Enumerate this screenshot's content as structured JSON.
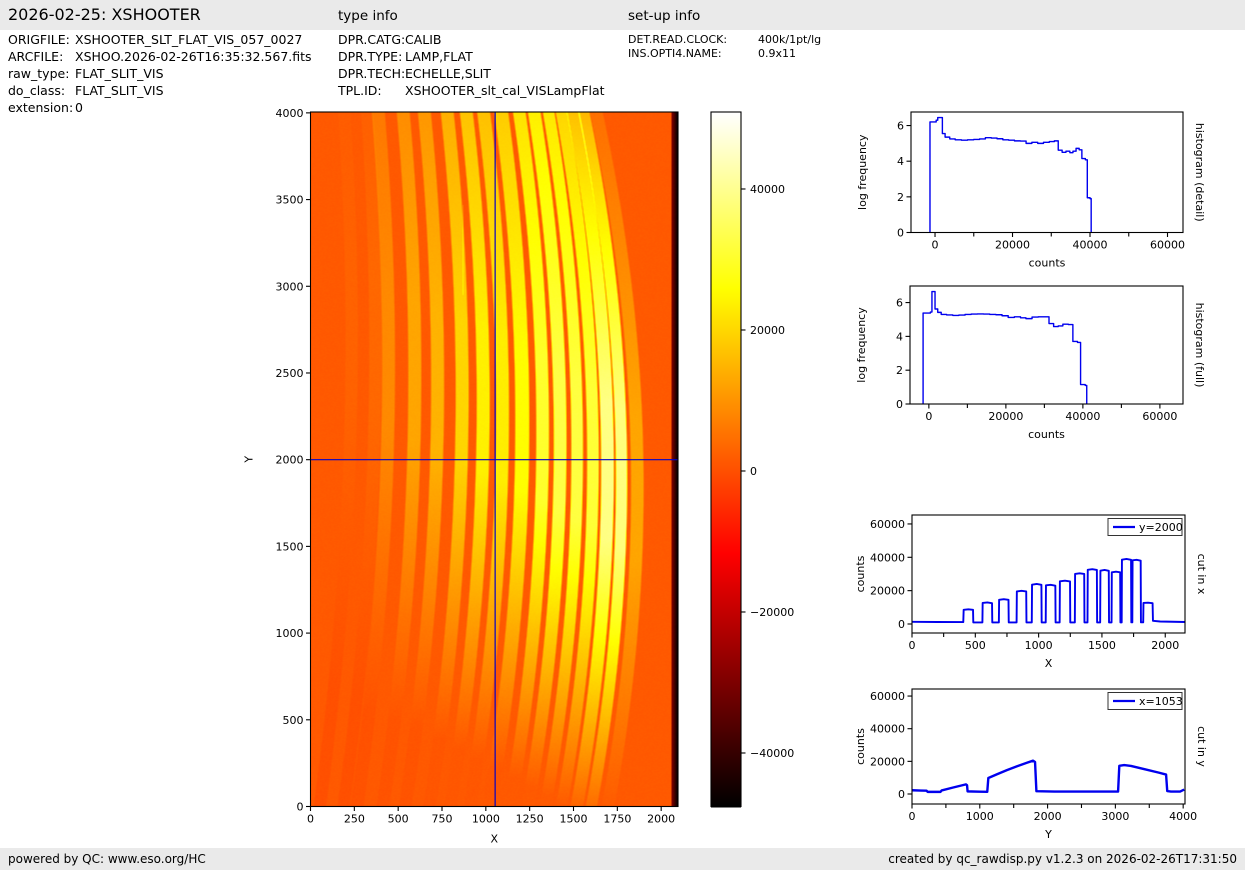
{
  "header": {
    "title": "2026-02-25: XSHOOTER",
    "type_info_title": "type info",
    "setup_info_title": "set-up info"
  },
  "file_info": {
    "rows": [
      {
        "label": "ORIGFILE:",
        "value": "XSHOOTER_SLT_FLAT_VIS_057_0027"
      },
      {
        "label": "ARCFILE:",
        "value": "XSHOO.2026-02-26T16:35:32.567.fits"
      },
      {
        "label": "raw_type:",
        "value": "FLAT_SLIT_VIS"
      },
      {
        "label": "do_class:",
        "value": "FLAT_SLIT_VIS"
      },
      {
        "label": "extension:",
        "value": "0"
      }
    ]
  },
  "type_info": {
    "rows": [
      {
        "label": "DPR.CATG:",
        "value": "CALIB"
      },
      {
        "label": "DPR.TYPE:",
        "value": "LAMP,FLAT"
      },
      {
        "label": "DPR.TECH:",
        "value": "ECHELLE,SLIT"
      },
      {
        "label": "TPL.ID:",
        "value": "XSHOOTER_slt_cal_VISLampFlat"
      }
    ]
  },
  "setup_info": {
    "rows": [
      {
        "label": "DET.READ.CLOCK:",
        "value": "400k/1pt/lg"
      },
      {
        "label": "INS.OPTI4.NAME:",
        "value": "0.9x11"
      }
    ]
  },
  "footer": {
    "left": "powered by QC: www.eso.org/HC",
    "right": "created by qc_rawdisp.py v1.2.3 on 2026-02-26T17:31:50"
  },
  "chart_data": [
    {
      "id": "image",
      "type": "heatmap",
      "colormap": "hot",
      "xlabel": "X",
      "ylabel": "Y",
      "xlim": [
        0,
        2096
      ],
      "ylim": [
        0,
        4005
      ],
      "xticks": [
        0,
        250,
        500,
        750,
        1000,
        1250,
        1500,
        1750,
        2000
      ],
      "yticks": [
        0,
        500,
        1000,
        1500,
        2000,
        2500,
        3000,
        3500,
        4000
      ],
      "background_value": 1500,
      "cursor": {
        "x": 1053,
        "y": 2000,
        "color": "#0000cc"
      },
      "stripe_fields": [
        "center",
        "halfwidth",
        "peak_counts",
        "curve_amp",
        "blaze_center_y",
        "top_fade"
      ],
      "stripes": [
        [
          235,
          35,
          2800,
          95,
          2700,
          0.7
        ],
        [
          370,
          35,
          3600,
          98,
          2650,
          0.7
        ],
        [
          445,
          37,
          8600,
          105,
          2550,
          0.72
        ],
        [
          595,
          37,
          12700,
          111,
          2495,
          0.72
        ],
        [
          725,
          37,
          14700,
          118,
          2440,
          0.72
        ],
        [
          865,
          37,
          19700,
          124,
          2385,
          0.72
        ],
        [
          985,
          37,
          23800,
          131,
          2330,
          0.72
        ],
        [
          1095,
          37,
          23300,
          137,
          2275,
          0.72
        ],
        [
          1208,
          40,
          25800,
          144,
          2220,
          0.72
        ],
        [
          1324,
          36,
          30200,
          150,
          2165,
          0.72
        ],
        [
          1424,
          36,
          32700,
          157,
          2110,
          0.72
        ],
        [
          1521,
          33,
          32200,
          163,
          2055,
          0.7
        ],
        [
          1611,
          33,
          31200,
          170,
          2000,
          0.64
        ],
        [
          1694,
          36,
          38800,
          176,
          1945,
          0.43
        ],
        [
          1774,
          32,
          38200,
          183,
          1890,
          0.4
        ],
        [
          1864,
          36,
          12700,
          189,
          1835,
          0.38
        ]
      ],
      "right_edge": {
        "x_start": 2062,
        "value": -30000
      },
      "artifact_line": {
        "x": 868,
        "y_from": 2950,
        "y_to": 3470,
        "delta": 5500
      }
    },
    {
      "id": "colorbar",
      "type": "colorbar",
      "colormap": "hot",
      "vmin": -47590,
      "vmax": 50920,
      "ticks": [
        40000,
        20000,
        0,
        -20000,
        -40000
      ]
    },
    {
      "id": "hist_detail",
      "type": "line",
      "mode": "step",
      "xlabel": "counts",
      "ylabel": "log frequency",
      "right_label": "histogram (detail)",
      "color": "#0000ee",
      "linewidth": 1.4,
      "xlim": [
        -6200,
        64000
      ],
      "ylim": [
        0,
        6.76
      ],
      "xticks": [
        0,
        20000,
        40000,
        60000
      ],
      "xminor": [
        10000,
        30000,
        50000
      ],
      "yticks": [
        0,
        2,
        4,
        6
      ],
      "points": [
        [
          -1300,
          6.2
        ],
        [
          300,
          6.3
        ],
        [
          700,
          6.45
        ],
        [
          1900,
          5.55
        ],
        [
          2600,
          5.35
        ],
        [
          3800,
          5.25
        ],
        [
          5200,
          5.2
        ],
        [
          6800,
          5.18
        ],
        [
          8400,
          5.2
        ],
        [
          10000,
          5.22
        ],
        [
          11500,
          5.25
        ],
        [
          13000,
          5.32
        ],
        [
          14500,
          5.3
        ],
        [
          16000,
          5.26
        ],
        [
          17500,
          5.2
        ],
        [
          19000,
          5.18
        ],
        [
          20500,
          5.14
        ],
        [
          22000,
          5.13
        ],
        [
          23500,
          5.0
        ],
        [
          25000,
          5.06
        ],
        [
          26500,
          5.0
        ],
        [
          28000,
          5.06
        ],
        [
          29500,
          5.1
        ],
        [
          30800,
          5.14
        ],
        [
          31800,
          4.62
        ],
        [
          32800,
          4.5
        ],
        [
          33800,
          4.56
        ],
        [
          34800,
          4.48
        ],
        [
          35600,
          4.56
        ],
        [
          36400,
          4.72
        ],
        [
          37200,
          4.64
        ],
        [
          37900,
          4.15
        ],
        [
          38800,
          4.08
        ],
        [
          39300,
          1.95
        ],
        [
          40000,
          1.9
        ],
        [
          40300,
          0
        ]
      ]
    },
    {
      "id": "hist_full",
      "type": "line",
      "mode": "step",
      "xlabel": "counts",
      "ylabel": "log frequency",
      "right_label": "histogram (full)",
      "color": "#0000ee",
      "linewidth": 1.4,
      "xlim": [
        -4900,
        66000
      ],
      "ylim": [
        0,
        6.98
      ],
      "xticks": [
        0,
        20000,
        40000,
        60000
      ],
      "xminor": [
        10000,
        30000,
        50000
      ],
      "yticks": [
        0,
        2,
        4,
        6
      ],
      "points": [
        [
          -1500,
          5.38
        ],
        [
          400,
          5.44
        ],
        [
          800,
          6.65
        ],
        [
          1600,
          5.62
        ],
        [
          2300,
          5.42
        ],
        [
          3200,
          5.3
        ],
        [
          4600,
          5.27
        ],
        [
          6200,
          5.24
        ],
        [
          7800,
          5.26
        ],
        [
          9400,
          5.3
        ],
        [
          11000,
          5.32
        ],
        [
          12600,
          5.33
        ],
        [
          14200,
          5.32
        ],
        [
          15800,
          5.3
        ],
        [
          17400,
          5.28
        ],
        [
          19000,
          5.22
        ],
        [
          20600,
          5.12
        ],
        [
          22200,
          5.16
        ],
        [
          23800,
          5.1
        ],
        [
          25200,
          5.05
        ],
        [
          26800,
          5.14
        ],
        [
          28400,
          5.16
        ],
        [
          30000,
          5.16
        ],
        [
          31200,
          4.76
        ],
        [
          32400,
          4.58
        ],
        [
          33600,
          4.62
        ],
        [
          34800,
          4.72
        ],
        [
          36200,
          4.7
        ],
        [
          37400,
          3.7
        ],
        [
          38600,
          3.64
        ],
        [
          39400,
          1.15
        ],
        [
          40600,
          1.1
        ],
        [
          41000,
          0
        ]
      ]
    },
    {
      "id": "cut_x",
      "type": "line",
      "mode": "line",
      "xlabel": "X",
      "ylabel": "counts",
      "right_label": "cut in x",
      "legend": "y=2000",
      "color": "#0000ee",
      "linewidth": 1.9,
      "xlim": [
        0,
        2156
      ],
      "ylim": [
        -5400,
        65370
      ],
      "xticks": [
        0,
        500,
        1000,
        1500,
        2000
      ],
      "xminor": [
        250,
        750,
        1250,
        1750
      ],
      "yticks": [
        0,
        20000,
        40000,
        60000
      ],
      "points": [
        [
          0,
          1300
        ],
        [
          200,
          1200
        ],
        [
          405,
          1150
        ],
        [
          408,
          8500
        ],
        [
          445,
          8800
        ],
        [
          482,
          8500
        ],
        [
          484,
          950
        ],
        [
          556,
          950
        ],
        [
          558,
          12600
        ],
        [
          595,
          12900
        ],
        [
          632,
          12500
        ],
        [
          634,
          950
        ],
        [
          686,
          950
        ],
        [
          688,
          14500
        ],
        [
          725,
          14900
        ],
        [
          762,
          14500
        ],
        [
          764,
          950
        ],
        [
          826,
          950
        ],
        [
          828,
          19500
        ],
        [
          865,
          19900
        ],
        [
          902,
          19500
        ],
        [
          904,
          950
        ],
        [
          946,
          950
        ],
        [
          948,
          23600
        ],
        [
          985,
          24000
        ],
        [
          1022,
          23500
        ],
        [
          1024,
          950
        ],
        [
          1056,
          950
        ],
        [
          1058,
          23200
        ],
        [
          1095,
          23500
        ],
        [
          1132,
          23000
        ],
        [
          1134,
          950
        ],
        [
          1166,
          950
        ],
        [
          1168,
          25600
        ],
        [
          1208,
          26000
        ],
        [
          1248,
          25500
        ],
        [
          1250,
          950
        ],
        [
          1286,
          950
        ],
        [
          1288,
          30000
        ],
        [
          1324,
          30400
        ],
        [
          1360,
          30000
        ],
        [
          1362,
          950
        ],
        [
          1386,
          950
        ],
        [
          1388,
          32500
        ],
        [
          1424,
          32900
        ],
        [
          1460,
          32400
        ],
        [
          1462,
          950
        ],
        [
          1486,
          950
        ],
        [
          1488,
          32000
        ],
        [
          1521,
          32400
        ],
        [
          1554,
          31900
        ],
        [
          1556,
          950
        ],
        [
          1576,
          950
        ],
        [
          1578,
          31000
        ],
        [
          1611,
          31400
        ],
        [
          1644,
          31000
        ],
        [
          1646,
          950
        ],
        [
          1656,
          950
        ],
        [
          1658,
          38600
        ],
        [
          1694,
          39000
        ],
        [
          1730,
          38500
        ],
        [
          1732,
          1000
        ],
        [
          1740,
          1000
        ],
        [
          1742,
          38200
        ],
        [
          1774,
          38500
        ],
        [
          1806,
          38000
        ],
        [
          1808,
          1000
        ],
        [
          1826,
          1000
        ],
        [
          1828,
          12600
        ],
        [
          1864,
          12800
        ],
        [
          1900,
          12500
        ],
        [
          1903,
          1900
        ],
        [
          1960,
          1500
        ],
        [
          2156,
          1200
        ]
      ]
    },
    {
      "id": "cut_y",
      "type": "line",
      "mode": "line",
      "xlabel": "Y",
      "ylabel": "counts",
      "right_label": "cut in y",
      "legend": "x=1053",
      "color": "#0000ee",
      "linewidth": 2.4,
      "xlim": [
        0,
        4027
      ],
      "ylim": [
        -6130,
        64320
      ],
      "xticks": [
        0,
        1000,
        2000,
        3000,
        4000
      ],
      "xminor": [
        500,
        1500,
        2500,
        3500
      ],
      "yticks": [
        0,
        20000,
        40000,
        60000
      ],
      "points": [
        [
          0,
          2300
        ],
        [
          130,
          2100
        ],
        [
          215,
          2000
        ],
        [
          232,
          1300
        ],
        [
          420,
          1300
        ],
        [
          438,
          2200
        ],
        [
          600,
          3900
        ],
        [
          795,
          5900
        ],
        [
          812,
          5400
        ],
        [
          820,
          1600
        ],
        [
          1000,
          1400
        ],
        [
          1110,
          1350
        ],
        [
          1126,
          9800
        ],
        [
          1250,
          12000
        ],
        [
          1400,
          14600
        ],
        [
          1550,
          17000
        ],
        [
          1700,
          19200
        ],
        [
          1785,
          20400
        ],
        [
          1815,
          19600
        ],
        [
          1835,
          1700
        ],
        [
          2100,
          1500
        ],
        [
          3040,
          1500
        ],
        [
          3058,
          17300
        ],
        [
          3130,
          17700
        ],
        [
          3230,
          17200
        ],
        [
          3430,
          15200
        ],
        [
          3640,
          13100
        ],
        [
          3748,
          11900
        ],
        [
          3765,
          1800
        ],
        [
          3820,
          1500
        ],
        [
          3955,
          1500
        ],
        [
          4015,
          2700
        ]
      ]
    }
  ]
}
